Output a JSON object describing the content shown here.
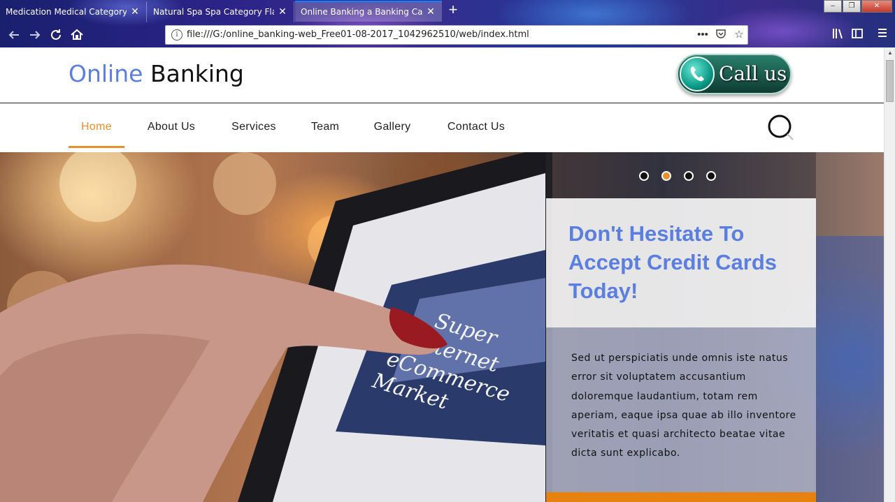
{
  "browser": {
    "tabs": [
      {
        "title": "Medication Medical Category Bootstrap Responsive Web Template",
        "close": "✕"
      },
      {
        "title": "Natural Spa Spa Category Flat Bootstrap Responsive Web Template",
        "close": "✕"
      },
      {
        "title": "Online Banking a Banking Category Flat Bootstrap Responsive Web Template",
        "close": "✕"
      }
    ],
    "new_tab": "+",
    "url": "file:///G:/online_banking-web_Free01-08-2017_1042962510/web/index.html",
    "window_controls": {
      "minimize": "–",
      "maximize": "❐",
      "close": "✕"
    }
  },
  "site": {
    "logo_part1": "Online",
    "logo_part2": "Banking",
    "callus_label": "Call us",
    "nav": [
      "Home",
      "About Us",
      "Services",
      "Team",
      "Gallery",
      "Contact Us"
    ],
    "active_nav": "Home"
  },
  "hero": {
    "screen_text": "Super Internet eCommerce Market",
    "title": "Don't Hesitate To Accept Credit Cards Today!",
    "body": "Sed ut perspiciatis unde omnis iste natus error sit voluptatem accusantium doloremque laudantium, totam rem aperiam, eaque ipsa quae ab illo inventore veritatis et quasi architecto beatae vitae dicta sunt explicabo.",
    "slide_count": 4,
    "active_slide": 2
  },
  "colors": {
    "brand_blue": "#5b7fe0",
    "accent_orange": "#e8902b"
  },
  "icons": [
    "back-icon",
    "forward-icon",
    "reload-icon",
    "home-icon",
    "info-icon",
    "more-icon",
    "pocket-icon",
    "bookmark-star-icon",
    "library-icon",
    "sidebar-icon",
    "menu-icon",
    "phone-icon",
    "search-icon"
  ]
}
